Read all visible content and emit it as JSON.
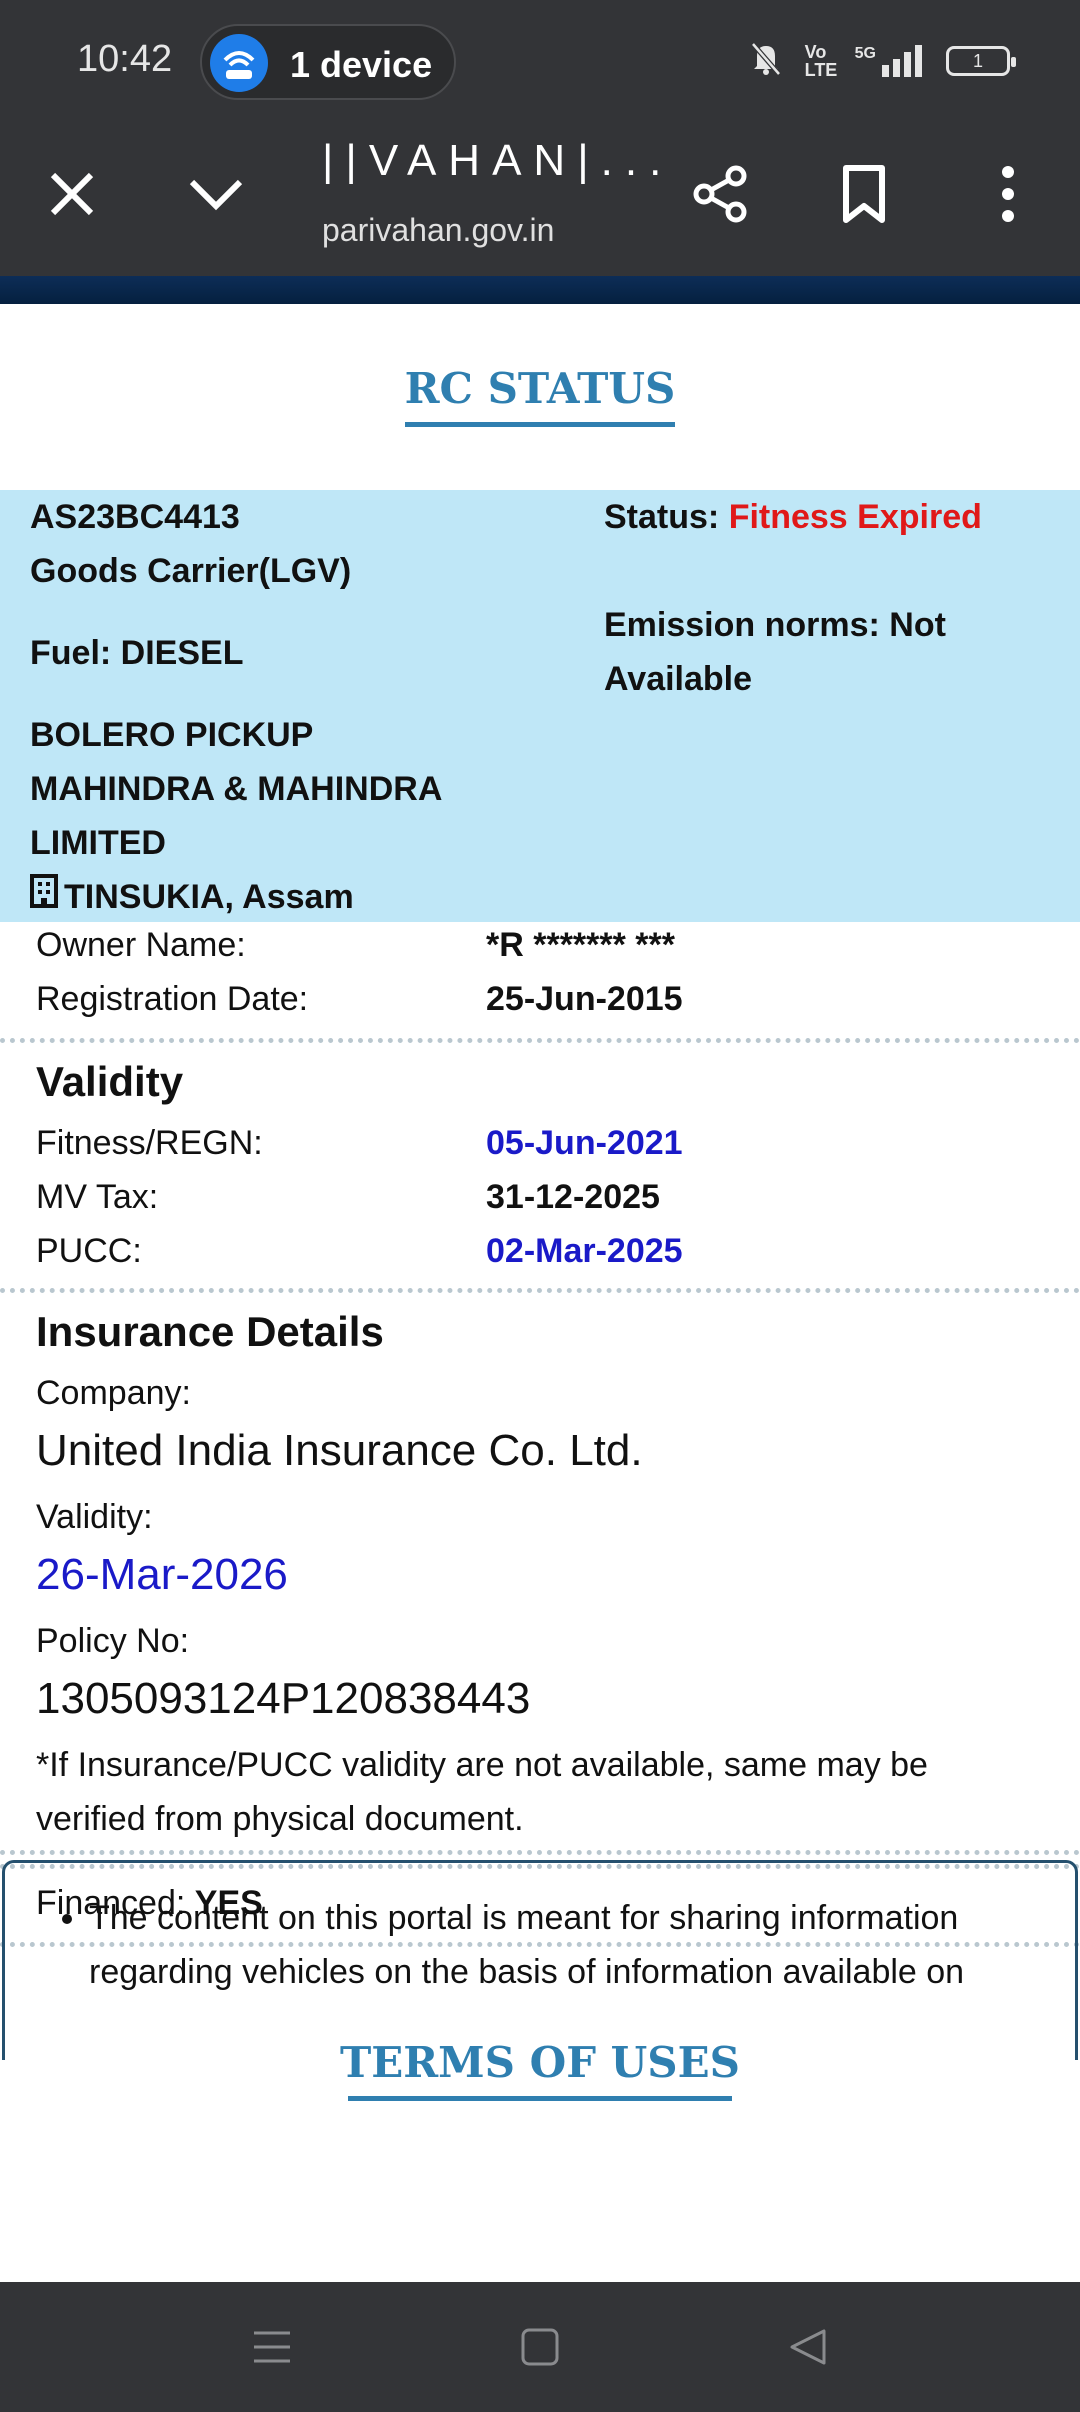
{
  "status_bar": {
    "time": "10:42",
    "hotspot_label": "1 device",
    "network_label": "Vo LTE",
    "signal_label": "5G",
    "battery_level": "1",
    "icons": [
      "wifi-hotspot-icon",
      "bell-muted-icon",
      "signal-icon",
      "battery-icon"
    ]
  },
  "browser": {
    "title": "||VAHAN|...",
    "url": "parivahan.gov.in",
    "icons": [
      "close-icon",
      "chevron-down-icon",
      "share-icon",
      "bookmark-icon",
      "more-vert-icon"
    ]
  },
  "rc": {
    "heading": "RC STATUS",
    "reg_no": "AS23BC4413",
    "vehicle_class": "Goods Carrier(LGV)",
    "fuel": "Fuel: DIESEL",
    "model": "BOLERO PICKUP",
    "maker_line1": "MAHINDRA & MAHINDRA",
    "maker_line2": "LIMITED",
    "location": "TINSUKIA, Assam",
    "status_label": "Status:",
    "status_value": "Fitness Expired",
    "emission_line1": "Emission norms: Not",
    "emission_line2": "Available"
  },
  "owner": {
    "owner_label": "Owner Name:",
    "owner_value": "*R ******* ***",
    "reg_date_label": "Registration Date:",
    "reg_date_value": "25-Jun-2015"
  },
  "validity": {
    "title": "Validity",
    "fitness_label": "Fitness/REGN:",
    "fitness_value": "05-Jun-2021",
    "tax_label": "MV Tax:",
    "tax_value": "31-12-2025",
    "pucc_label": "PUCC:",
    "pucc_value": "02-Mar-2025"
  },
  "insurance": {
    "title": "Insurance Details",
    "company_label": "Company:",
    "company_value": "United India Insurance Co. Ltd.",
    "validity_label": "Validity:",
    "validity_value": "26-Mar-2026",
    "policy_label": "Policy No:",
    "policy_value": "1305093124P120838443",
    "note": "*If Insurance/PUCC validity are not available, same may be verified from physical document."
  },
  "financed": {
    "label": "Financed:",
    "value": "YES"
  },
  "terms": {
    "heading": "TERMS OF USES",
    "item1": "The content on this portal is meant for sharing information regarding vehicles on the basis of information available on"
  },
  "nav": {
    "icons": [
      "menu-icon",
      "home-square-icon",
      "back-triangle-icon"
    ]
  }
}
